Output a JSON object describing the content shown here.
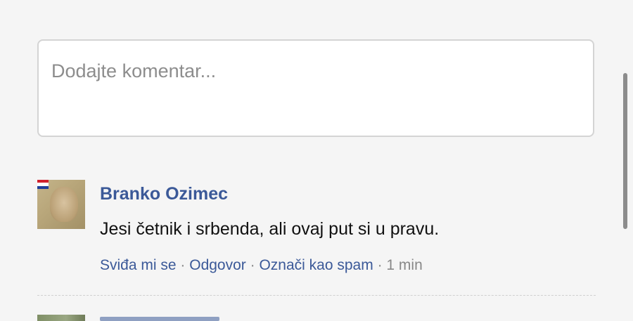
{
  "comment_form": {
    "placeholder": "Dodajte komentar..."
  },
  "comments": [
    {
      "author": "Branko Ozimec",
      "text": "Jesi četnik i srbenda, ali ovaj put si u pravu.",
      "actions": {
        "like": "Sviđa mi se",
        "reply": "Odgovor",
        "spam": "Označi kao spam",
        "separator": "·",
        "time": "1 min"
      }
    }
  ],
  "colors": {
    "link": "#3b5998",
    "placeholder": "#8d8d8d",
    "background": "#f5f5f5"
  },
  "icons": {
    "flag": "croatian-flag-icon"
  }
}
